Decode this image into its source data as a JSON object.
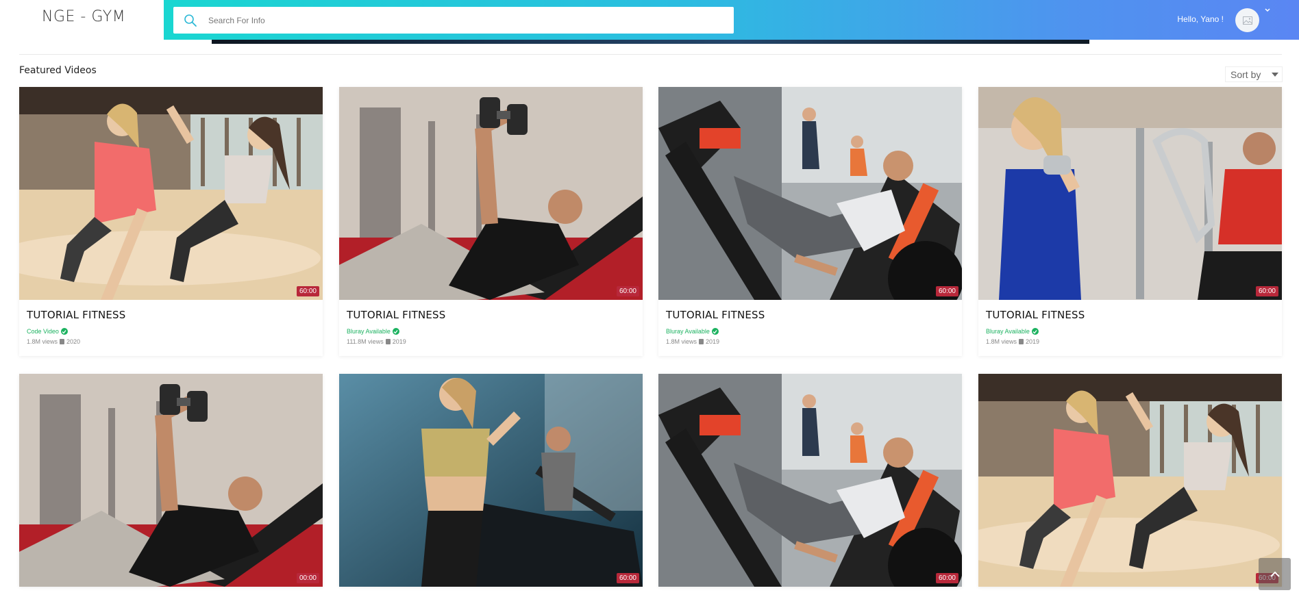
{
  "brand": {
    "logo_text": "NGE - GYM"
  },
  "header": {
    "search_placeholder": "Search For Info",
    "greeting": "Hello, Yano !",
    "avatar_icon": "image-placeholder-icon",
    "colors": {
      "gradient_start": "#1ad6d1",
      "gradient_end": "#5a86f3"
    }
  },
  "section": {
    "title": "Featured Videos",
    "sort_label": "Sort by"
  },
  "videos": [
    {
      "title": "TUTORIAL FITNESS",
      "badge": "Code Video",
      "views": "1.8M views",
      "year": "2020",
      "duration": "60:00",
      "scene": "pushup-highfive"
    },
    {
      "title": "TUTORIAL FITNESS",
      "badge": "Bluray Available",
      "views": "111.8M views",
      "year": "2019",
      "duration": "60:00",
      "scene": "dumbbell-press"
    },
    {
      "title": "TUTORIAL FITNESS",
      "badge": "Bluray Available",
      "views": "1.8M views",
      "year": "2019",
      "duration": "60:00",
      "scene": "leg-press"
    },
    {
      "title": "TUTORIAL FITNESS",
      "badge": "Bluray Available",
      "views": "1.8M views",
      "year": "2019",
      "duration": "60:00",
      "scene": "dumbbell-curl"
    },
    {
      "title": "",
      "badge": "",
      "views": "",
      "year": "",
      "duration": "00:00",
      "scene": "dumbbell-press"
    },
    {
      "title": "",
      "badge": "",
      "views": "",
      "year": "",
      "duration": "60:00",
      "scene": "treadmill"
    },
    {
      "title": "",
      "badge": "",
      "views": "",
      "year": "",
      "duration": "60:00",
      "scene": "leg-press"
    },
    {
      "title": "",
      "badge": "",
      "views": "",
      "year": "",
      "duration": "60:00",
      "scene": "pushup-highfive"
    }
  ],
  "back_to_top_icon": "chevron-up-icon",
  "accent_colors": {
    "verified": "#1cb260",
    "duration_badge": "#b8283a"
  }
}
